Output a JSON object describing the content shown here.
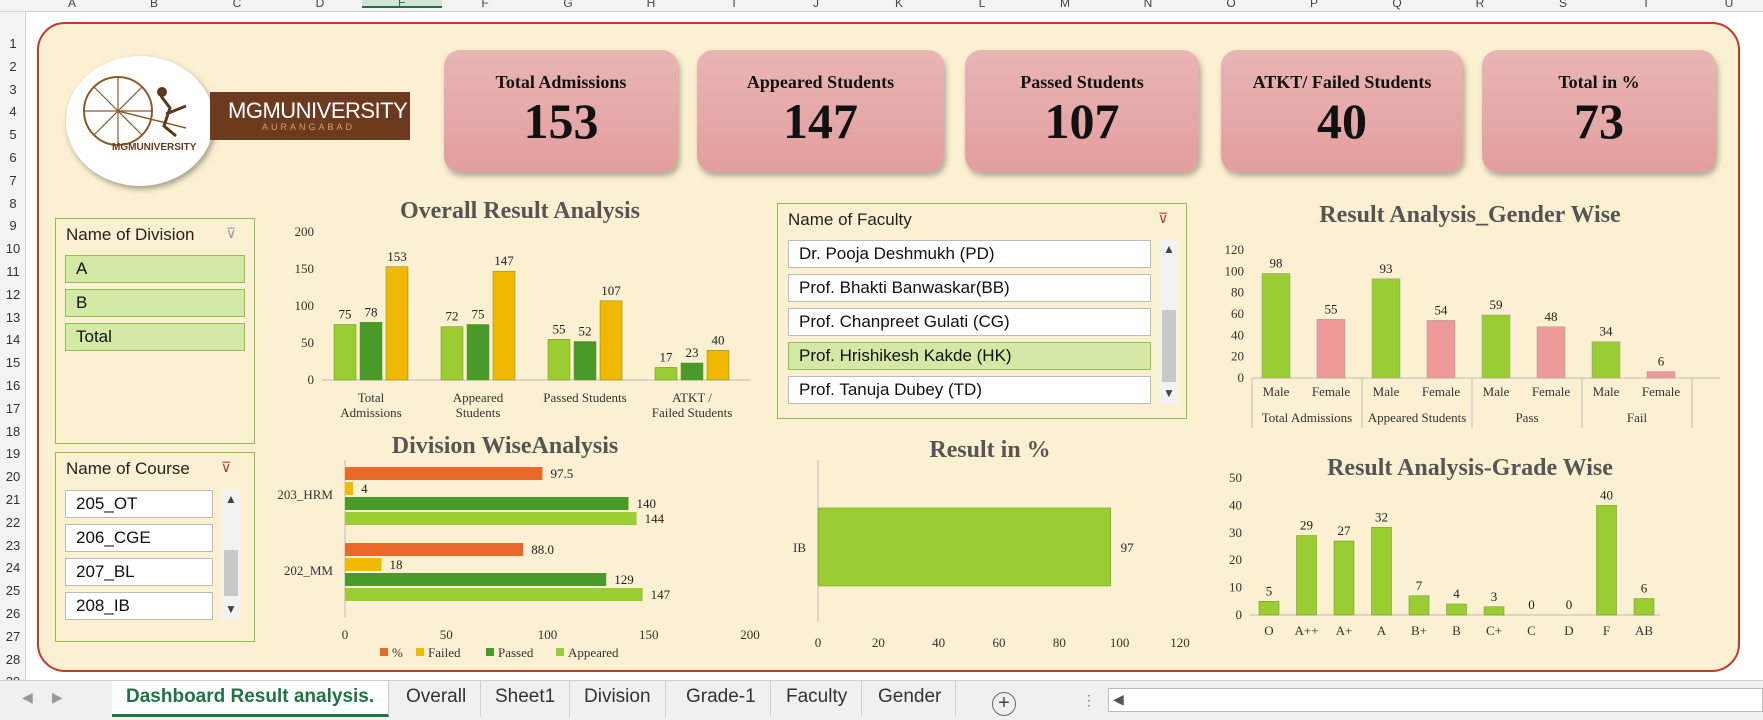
{
  "columns": [
    "A",
    "B",
    "C",
    "D",
    "E",
    "F",
    "G",
    "H",
    "I",
    "J",
    "K",
    "L",
    "M",
    "N",
    "O",
    "P",
    "Q",
    "R",
    "S",
    "T",
    "U"
  ],
  "selected_column": "E",
  "rows": [
    "1",
    "2",
    "3",
    "4",
    "5",
    "6",
    "7",
    "8",
    "9",
    "10",
    "11",
    "12",
    "13",
    "14",
    "15",
    "16",
    "17",
    "18",
    "19",
    "20",
    "21",
    "22",
    "23",
    "24",
    "25",
    "26",
    "27",
    "28",
    "29"
  ],
  "logo": {
    "brand": "MGMUNIVERSITY",
    "city": "AURANGABAD",
    "seal_text": "MGMUNIVERSITY"
  },
  "kpis": [
    {
      "label": "Total Admissions",
      "value": "153"
    },
    {
      "label": "Appeared Students",
      "value": "147"
    },
    {
      "label": "Passed Students",
      "value": "107"
    },
    {
      "label": "ATKT/ Failed Students",
      "value": "40"
    },
    {
      "label": "Total in %",
      "value": "73"
    }
  ],
  "division_slicer": {
    "title": "Name of Division",
    "items": [
      "A",
      "B",
      "Total"
    ]
  },
  "course_slicer": {
    "title": "Name of Course",
    "items": [
      "205_OT",
      "206_CGE",
      "207_BL",
      "208_IB"
    ]
  },
  "faculty_slicer": {
    "title": "Name of Faculty",
    "items": [
      "Dr. Pooja Deshmukh (PD)",
      "Prof. Bhakti Banwaskar(BB)",
      "Prof. Chanpreet Gulati (CG)",
      "Prof. Hrishikesh Kakde (HK)",
      "Prof. Tanuja Dubey (TD)"
    ],
    "selected": "Prof. Hrishikesh Kakde (HK)"
  },
  "colors": {
    "light_green": "#9acd32",
    "dark_green": "#4a9a2a",
    "gold": "#f1b800",
    "orange": "#e9682a",
    "pink": "#ee9a9a",
    "border_red": "#c0392b",
    "canvas": "#fbf0d1"
  },
  "chart_data": [
    {
      "id": "overall",
      "type": "bar",
      "title": "Overall Result Analysis",
      "categories": [
        "Total Admissions",
        "Appeared Students",
        "Passed Students",
        "ATKT / Failed Students"
      ],
      "series": [
        {
          "values": [
            75,
            72,
            55,
            17
          ]
        },
        {
          "values": [
            78,
            75,
            52,
            23
          ]
        },
        {
          "values": [
            153,
            147,
            107,
            40
          ]
        }
      ],
      "ylim": [
        0,
        200
      ],
      "yticks": [
        "0",
        "50",
        "100",
        "150",
        "200"
      ]
    },
    {
      "id": "gender",
      "type": "bar",
      "title": "Result Analysis_Gender Wise",
      "groups": [
        "Total Admissions",
        "Appeared Students",
        "Pass",
        "Fail"
      ],
      "categories": [
        "Male",
        "Female",
        "Male",
        "Female",
        "Male",
        "Female",
        "Male",
        "Female"
      ],
      "values": [
        98,
        55,
        93,
        54,
        59,
        48,
        34,
        6
      ],
      "ylim": [
        0,
        120
      ],
      "yticks": [
        "0",
        "20",
        "40",
        "60",
        "80",
        "100",
        "120"
      ]
    },
    {
      "id": "division",
      "type": "bar",
      "orientation": "horizontal",
      "title": "Division WiseAnalysis",
      "categories": [
        "203_HRM",
        "202_MM"
      ],
      "series": [
        {
          "name": "%",
          "values": [
            97.5,
            88.0
          ],
          "labels": [
            "97.5",
            "88.0"
          ]
        },
        {
          "name": "Failed",
          "values": [
            4,
            18
          ],
          "labels": [
            "4",
            "18"
          ]
        },
        {
          "name": "Passed",
          "values": [
            140,
            129
          ],
          "labels": [
            "140",
            "129"
          ]
        },
        {
          "name": "Appeared",
          "values": [
            144,
            147
          ],
          "labels": [
            "144",
            "147"
          ]
        }
      ],
      "xlim": [
        0,
        200
      ],
      "xticks": [
        "0",
        "50",
        "100",
        "150",
        "200"
      ],
      "legend": "bottom"
    },
    {
      "id": "percent",
      "type": "bar",
      "orientation": "horizontal",
      "title": "Result in %",
      "categories": [
        "IB"
      ],
      "values": [
        97
      ],
      "xlim": [
        0,
        120
      ],
      "xticks": [
        "0",
        "20",
        "40",
        "60",
        "80",
        "100",
        "120"
      ]
    },
    {
      "id": "grade",
      "type": "bar",
      "title": "Result Analysis-Grade Wise",
      "categories": [
        "O",
        "A++",
        "A+",
        "A",
        "B+",
        "B",
        "C+",
        "C",
        "D",
        "F",
        "AB"
      ],
      "values": [
        5,
        29,
        27,
        32,
        7,
        4,
        3,
        0,
        0,
        40,
        6
      ],
      "ylim": [
        0,
        50
      ],
      "yticks": [
        "0",
        "10",
        "20",
        "30",
        "40",
        "50"
      ]
    }
  ],
  "sheet_tabs": [
    "Dashboard Result analysis.",
    "Overall",
    "Sheet1",
    "Division",
    "Grade-1",
    "Faculty",
    "Gender"
  ],
  "active_tab": "Dashboard Result analysis.",
  "add_sheet_symbol": "+",
  "tab_dots": "⋮"
}
